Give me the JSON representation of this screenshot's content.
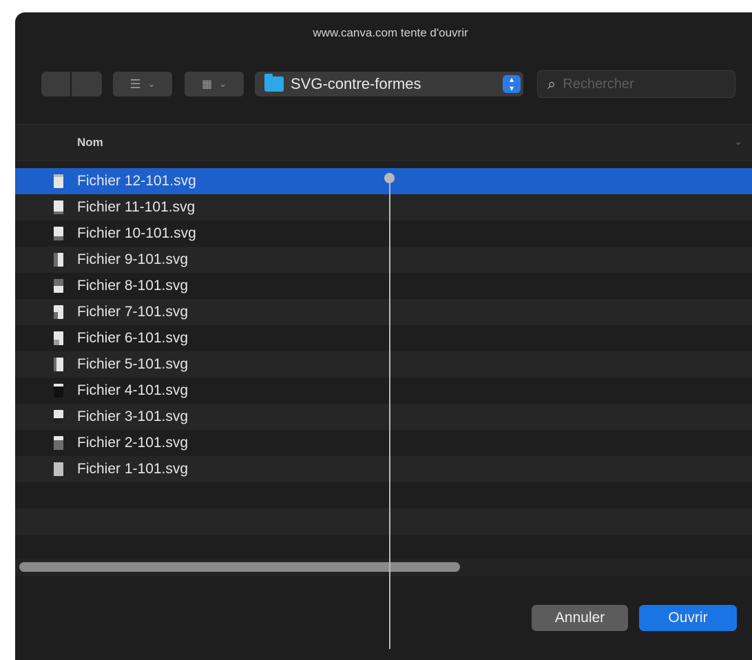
{
  "window": {
    "title": "www.canva.com tente d'ouvrir"
  },
  "toolbar": {
    "view_list_icon": "list-view-icon",
    "view_grid_icon": "grid-view-icon",
    "path_folder": "SVG-contre-formes",
    "search_placeholder": "Rechercher"
  },
  "list": {
    "column_name": "Nom",
    "files": [
      {
        "name": "Fichier 12-101.svg",
        "selected": true
      },
      {
        "name": "Fichier 11-101.svg",
        "selected": false
      },
      {
        "name": "Fichier 10-101.svg",
        "selected": false
      },
      {
        "name": "Fichier 9-101.svg",
        "selected": false
      },
      {
        "name": "Fichier 8-101.svg",
        "selected": false
      },
      {
        "name": "Fichier 7-101.svg",
        "selected": false
      },
      {
        "name": "Fichier 6-101.svg",
        "selected": false
      },
      {
        "name": "Fichier 5-101.svg",
        "selected": false
      },
      {
        "name": "Fichier 4-101.svg",
        "selected": false
      },
      {
        "name": "Fichier 3-101.svg",
        "selected": false
      },
      {
        "name": "Fichier 2-101.svg",
        "selected": false
      },
      {
        "name": "Fichier 1-101.svg",
        "selected": false
      }
    ]
  },
  "footer": {
    "cancel_label": "Annuler",
    "open_label": "Ouvrir"
  },
  "colors": {
    "window_bg": "#1e1e1e",
    "selection": "#1d5fcb",
    "primary_button": "#1b74e4",
    "folder": "#2ea7e8"
  }
}
